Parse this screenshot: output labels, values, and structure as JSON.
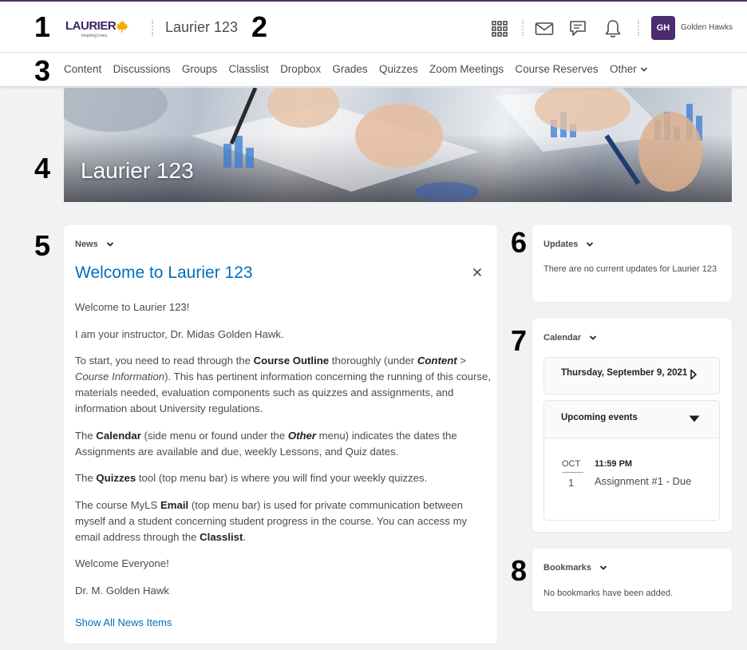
{
  "callouts": {
    "n1": "1",
    "n2": "2",
    "n3": "3",
    "n4": "4",
    "n5": "5",
    "n6": "6",
    "n7": "7",
    "n8": "8"
  },
  "header": {
    "logo_text": "LAURIER",
    "logo_tagline": "Inspiring Lives.",
    "course_title": "Laurier 123",
    "icons": [
      "apps-grid-icon",
      "email-icon",
      "chat-icon",
      "bell-icon"
    ],
    "avatar_initials": "GH",
    "username": "Golden Hawks"
  },
  "nav": {
    "items": [
      "Content",
      "Discussions",
      "Groups",
      "Classlist",
      "Dropbox",
      "Grades",
      "Quizzes",
      "Zoom Meetings",
      "Course Reserves",
      "Other"
    ]
  },
  "banner": {
    "title": "Laurier 123"
  },
  "news": {
    "heading": "News",
    "title": "Welcome to Laurier 123",
    "p1": "Welcome to Laurier 123!",
    "p2": "I am your instructor, Dr. Midas Golden Hawk.",
    "p3a": "To start, you need to read through the ",
    "p3b": "Course Outline",
    "p3c": " thoroughly (under ",
    "p3d": "Content",
    "p3e": " > ",
    "p3f": "Course Information",
    "p3g": "). This has pertinent information concerning the running of this course, materials needed, evaluation components such as quizzes and assignments, and information about University regulations.",
    "p4a": "The ",
    "p4b": "Calendar",
    "p4c": " (side menu or found under the ",
    "p4d": "Other",
    "p4e": " menu) indicates the dates the Assignments are available and due, weekly Lessons, and Quiz dates.",
    "p5a": "The ",
    "p5b": "Quizzes",
    "p5c": " tool (top menu bar) is where you will find your weekly quizzes.",
    "p6a": "The course MyLS ",
    "p6b": "Email",
    "p6c": " (top menu bar) is used for private communication between myself and a student concerning student progress in the course.  You can access my email address through the ",
    "p6d": "Classlist",
    "p6e": ".",
    "p7": "Welcome Everyone!",
    "p8": "Dr. M. Golden Hawk",
    "show_all": "Show All News Items"
  },
  "updates": {
    "heading": "Updates",
    "text": "There are no current updates for Laurier 123"
  },
  "calendar": {
    "heading": "Calendar",
    "date": "Thursday, September 9, 2021",
    "upcoming": "Upcoming events",
    "event_month": "OCT",
    "event_day": "1",
    "event_time": "11:59 PM",
    "event_title": "Assignment #1 - Due"
  },
  "bookmarks": {
    "heading": "Bookmarks",
    "text": "No bookmarks have been added."
  },
  "colors": {
    "brand": "#4b2c6e",
    "link": "#006fbf"
  }
}
